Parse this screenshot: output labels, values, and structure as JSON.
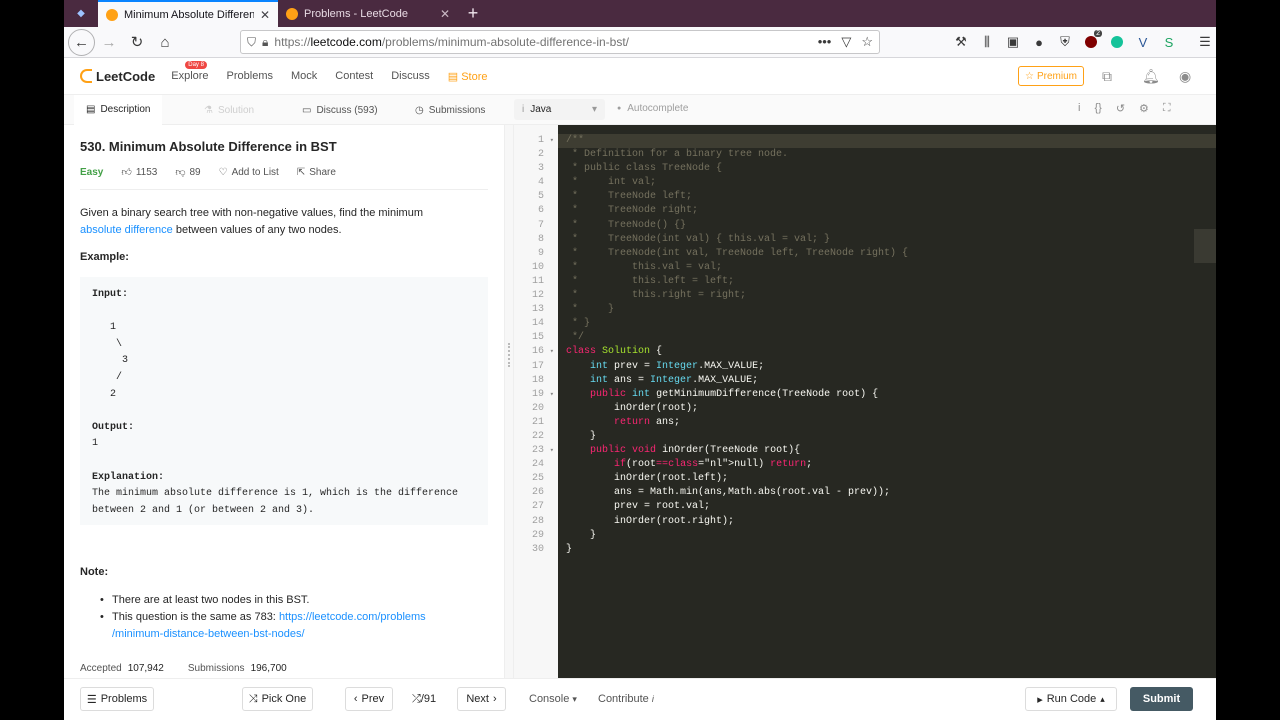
{
  "browser": {
    "tabs": [
      {
        "title": "Minimum Absolute Difference in BST - LeetCode",
        "active": true
      },
      {
        "title": "Problems - LeetCode",
        "active": false
      }
    ],
    "url_prefix": "https://",
    "url_host": "leetcode.com",
    "url_path": "/problems/minimum-absolute-difference-in-bst/",
    "extension_badge": "2"
  },
  "lc_nav": {
    "logo": "LeetCode",
    "links": [
      "Explore",
      "Problems",
      "Mock",
      "Contest",
      "Discuss"
    ],
    "explore_badge": "Day 8",
    "store": "Store",
    "premium": "Premium"
  },
  "panel_tabs": {
    "description": "Description",
    "solution": "Solution",
    "discuss": "Discuss (593)",
    "submissions": "Submissions"
  },
  "editor_bar": {
    "language": "Java",
    "autocomplete": "Autocomplete"
  },
  "problem": {
    "title": "530. Minimum Absolute Difference in BST",
    "difficulty": "Easy",
    "likes": "1153",
    "dislikes": "89",
    "add_to_list": "Add to List",
    "share": "Share",
    "desc_part1": "Given a binary search tree with non-negative values, find the minimum",
    "desc_link": "absolute difference",
    "desc_part2": "between values of any two nodes.",
    "example_label": "Example:",
    "input_label": "Input:",
    "tree_lines": [
      "   1",
      "    \\",
      "     3",
      "    /",
      "   2"
    ],
    "output_label": "Output:",
    "output_value": "1",
    "explanation_label": "Explanation:",
    "explanation_lines": [
      "The minimum absolute difference is 1, which is the difference",
      "between 2 and 1 (or between 2 and 3)."
    ],
    "note_label": "Note:",
    "note1": "There are at least two nodes in this BST.",
    "note2_text": "This question is the same as 783:",
    "note2_link_a": "https://leetcode.com/problems",
    "note2_link_b": "/minimum-distance-between-bst-nodes/",
    "accepted_label": "Accepted",
    "accepted_value": "107,942",
    "submissions_label": "Submissions",
    "submissions_value": "196,700"
  },
  "code_lines": [
    "/**",
    " * Definition for a binary tree node.",
    " * public class TreeNode {",
    " *     int val;",
    " *     TreeNode left;",
    " *     TreeNode right;",
    " *     TreeNode() {}",
    " *     TreeNode(int val) { this.val = val; }",
    " *     TreeNode(int val, TreeNode left, TreeNode right) {",
    " *         this.val = val;",
    " *         this.left = left;",
    " *         this.right = right;",
    " *     }",
    " * }",
    " */",
    "class Solution {",
    "    int prev = Integer.MAX_VALUE;",
    "    int ans = Integer.MAX_VALUE;",
    "    public int getMinimumDifference(TreeNode root) {",
    "        inOrder(root);",
    "        return ans;",
    "    }",
    "    public void inOrder(TreeNode root){",
    "        if(root==null) return;",
    "        inOrder(root.left);",
    "        ans = Math.min(ans,Math.abs(root.val - prev));",
    "        prev = root.val;",
    "        inOrder(root.right);",
    "    }",
    "}"
  ],
  "fold_lines": [
    1,
    16,
    19,
    23
  ],
  "footer": {
    "problems": "Problems",
    "pick_one": "Pick One",
    "prev": "Prev",
    "page": "/91",
    "next": "Next",
    "console": "Console",
    "contribute": "Contribute",
    "run_code": "Run Code",
    "submit": "Submit"
  }
}
